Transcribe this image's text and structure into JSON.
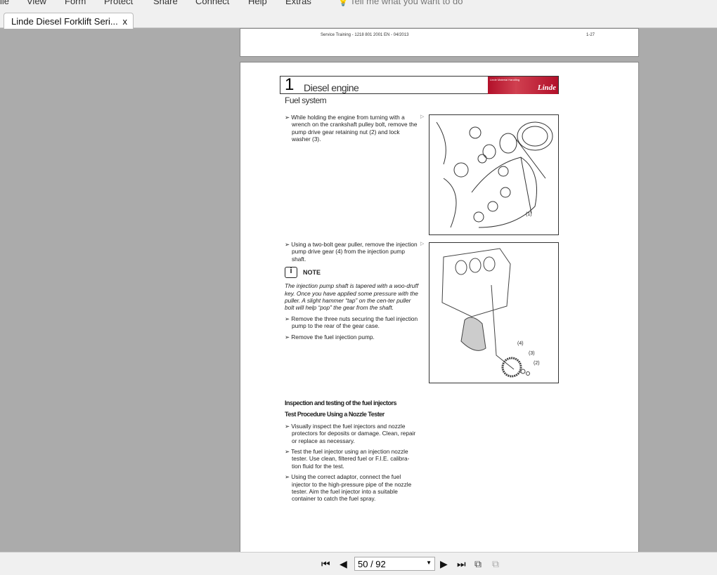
{
  "menu": [
    "File",
    "View",
    "Form",
    "Protect",
    "Share",
    "Connect",
    "Help",
    "Extras"
  ],
  "tell_me": "Tell me what you want to do",
  "tab": {
    "title": "Linde Diesel Forklift Seri...",
    "close": "x"
  },
  "prev_page": {
    "header": "Service Training - 1218 801 2001 EN - 04/2013",
    "page_num": "1-27"
  },
  "page": {
    "chapter_num": "1",
    "chapter_title": "Diesel engine",
    "logo_tagline": "Linde Material Handling",
    "logo": "Linde",
    "section": "Fuel system",
    "step1": "While holding the engine from turning with a wrench on the crankshaft pulley bolt, remove the pump drive gear retaining nut (2) and lock washer (3).",
    "step2": "Using a two-bolt gear puller, remove the injection pump drive gear (4) from the injection pump shaft.",
    "note_label": "NOTE",
    "note_text": "The injection pump shaft is tapered with a woo-druff key. Once you have applied some pressure with the puller. A slight hammer “tap” on the cen-ter puller bolt will help “pop” the gear from the shaft.",
    "step3": "Remove the three nuts securing the fuel injection pump to the rear of the gear case.",
    "step4": "Remove the fuel injection pump.",
    "fig1_labels": [
      "(1)"
    ],
    "fig2_labels": [
      "(4)",
      "(3)",
      "(2)"
    ],
    "heading2": "Inspection and testing of the fuel injectors",
    "heading3": "Test Procedure Using a Nozzle Tester",
    "step5": "Visually inspect the fuel injectors and nozzle protectors for deposits or damage.  Clean, repair or replace as necessary.",
    "step6": "Test the fuel injector using an injection nozzle tester.  Use clean, filtered fuel or F.I.E. calibra-tion fluid for the test.",
    "step7": "Using the correct adaptor, connect the fuel injector to the high-pressure pipe of the nozzle tester.  Aim the fuel injector into a suitable container to catch the fuel spray."
  },
  "nav": {
    "page_indicator": "50 / 92"
  }
}
